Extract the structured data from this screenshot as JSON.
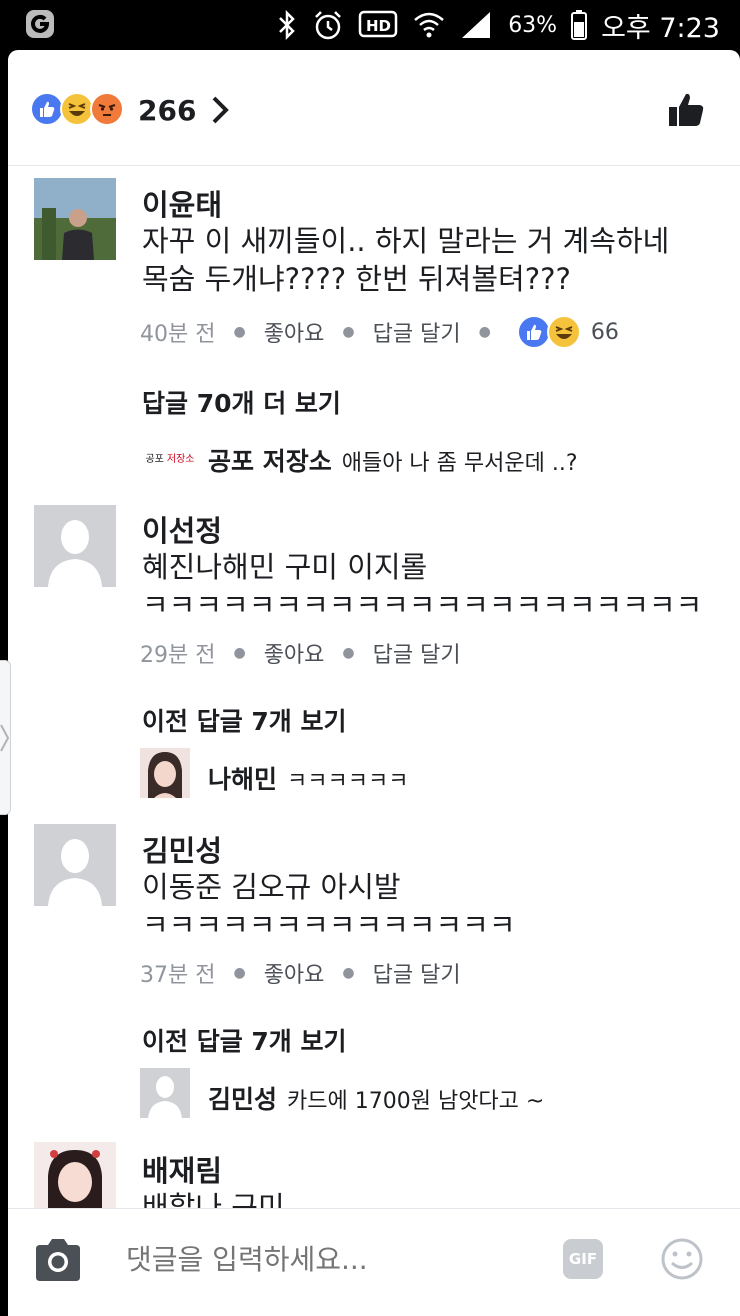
{
  "status_bar": {
    "battery_percent": "63%",
    "time": "오후 7:23",
    "icons": [
      "app-g-icon",
      "bluetooth-icon",
      "alarm-icon",
      "hd-icon",
      "wifi-icon",
      "signal-icon",
      "battery-icon"
    ]
  },
  "reactions": {
    "count": "266",
    "icons": [
      "like-reaction-icon",
      "haha-reaction-icon",
      "angry-reaction-icon"
    ]
  },
  "comments": [
    {
      "name": "이윤태",
      "lines": [
        "자꾸 이 새끼들이.. 하지 말라는 거 계속하네",
        "목숨 두개냐???? 한번 뒤져볼텨???"
      ],
      "time": "40분 전",
      "like_label": "좋아요",
      "reply_label": "답글 달기",
      "reaction_count": "66",
      "more_replies": "답글 70개 더 보기",
      "reply": {
        "logo_left": "공포",
        "logo_right": "저장소",
        "name": "공포 저장소",
        "text": "애들아 나 좀 무서운데 ..?"
      }
    },
    {
      "name": "이선정",
      "lines": [
        "혜진나해민 구미 이지롤",
        "ㅋㅋㅋㅋㅋㅋㅋㅋㅋㅋㅋㅋㅋㅋㅋㅋㅋㅋㅋㅋㅋ"
      ],
      "time": "29분 전",
      "like_label": "좋아요",
      "reply_label": "답글 달기",
      "more_replies": "이전 답글 7개 보기",
      "reply": {
        "name": "나해민",
        "text": "ㅋㅋㅋㅋㅋㅋ"
      }
    },
    {
      "name": "김민성",
      "lines": [
        "이동준 김오규 아시발",
        "ㅋㅋㅋㅋㅋㅋㅋㅋㅋㅋㅋㅋㅋㅋ"
      ],
      "time": "37분 전",
      "like_label": "좋아요",
      "reply_label": "답글 달기",
      "more_replies": "이전 답글 7개 보기",
      "reply": {
        "name": "김민성",
        "text": "카드에 1700원 남앗다고 ~"
      }
    },
    {
      "name": "배재림",
      "lines": [
        "배할나 구미"
      ]
    }
  ],
  "composer": {
    "placeholder": "댓글을 입력하세요...",
    "gif_label": "GIF"
  },
  "colors": {
    "like_blue": "#4a78f0",
    "haha_yellow": "#f5c33b",
    "angry_orange": "#f07a3a",
    "meta_gray": "#90949c"
  }
}
